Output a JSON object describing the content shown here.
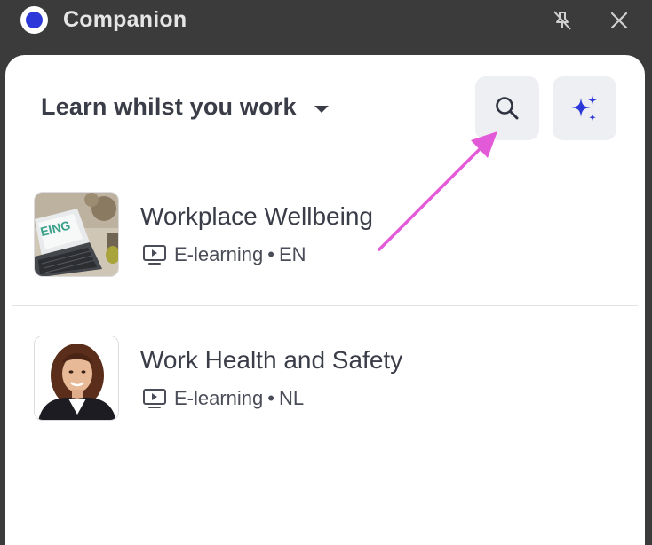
{
  "window": {
    "title": "Companion",
    "icons": [
      "app-logo-icon",
      "unpin-icon",
      "close-icon"
    ]
  },
  "header": {
    "dropdown_label": "Learn whilst you work",
    "buttons": [
      {
        "name": "search",
        "icon": "search-icon"
      },
      {
        "name": "ai-assist",
        "icon": "sparkles-icon"
      }
    ]
  },
  "courses": [
    {
      "title": "Workplace Wellbeing",
      "type": "E-learning",
      "separator": "•",
      "language": "EN",
      "thumbnail": "laptop-desk-photo",
      "thumbnail_text": "EING"
    },
    {
      "title": "Work Health and Safety",
      "type": "E-learning",
      "separator": "•",
      "language": "NL",
      "thumbnail": "woman-portrait-photo"
    }
  ],
  "colors": {
    "titlebar": "#3b3b3b",
    "panel": "#ffffff",
    "button_bg": "#eeeff2",
    "text": "#3a3d48",
    "accent_blue": "#2d38d8",
    "annotation_arrow": "#e35ad8"
  }
}
